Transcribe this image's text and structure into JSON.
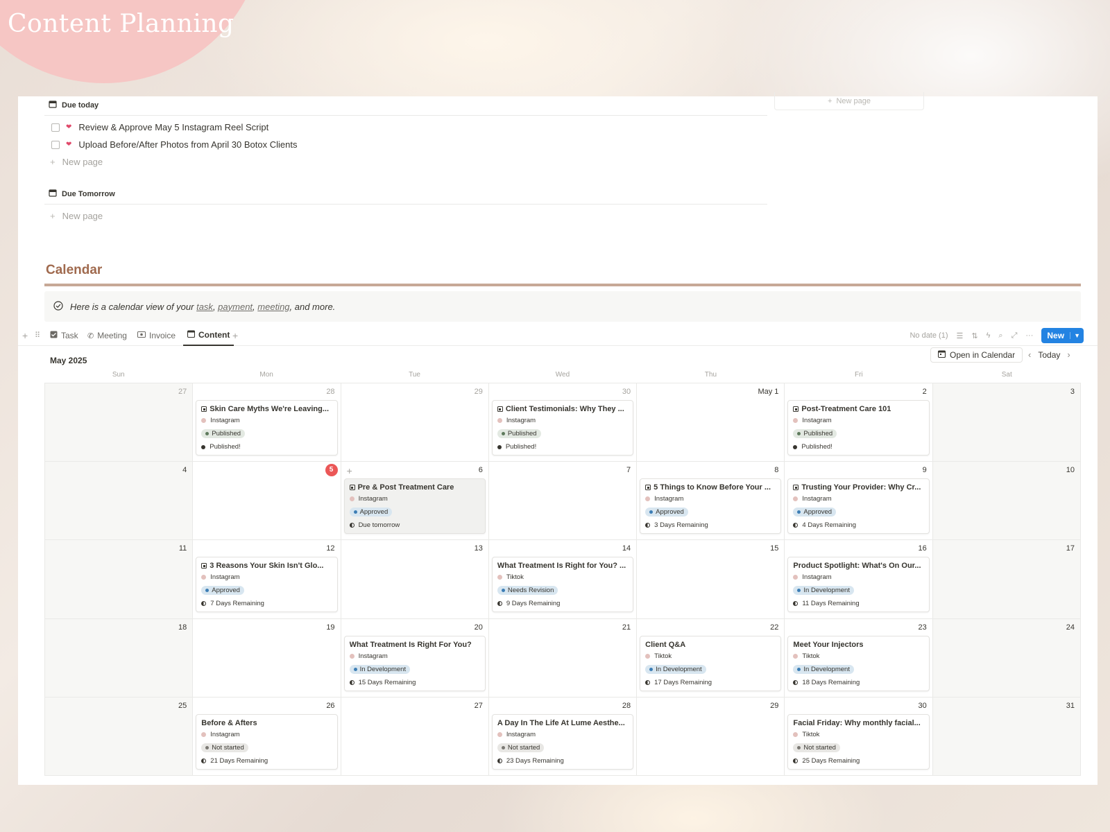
{
  "header": {
    "title": "Content Planning"
  },
  "due_today": {
    "label": "Due today",
    "items": [
      "Review & Approve May 5 Instagram Reel Script",
      "Upload Before/After Photos from April 30 Botox Clients"
    ],
    "new_page": "New page"
  },
  "due_tomorrow": {
    "label": "Due Tomorrow",
    "new_page": "New page"
  },
  "gallery": {
    "new_page": "New page"
  },
  "calendar": {
    "title": "Calendar",
    "callout_prefix": "Here is a calendar view of your ",
    "callout_task": "task",
    "callout_sep1": ", ",
    "callout_payment": "payment",
    "callout_sep2": ", ",
    "callout_meeting": "meeting",
    "callout_suffix": ", and more."
  },
  "tabs": [
    {
      "label": "Task",
      "icon": "checkbox-icon"
    },
    {
      "label": "Meeting",
      "icon": "phone-icon"
    },
    {
      "label": "Invoice",
      "icon": "money-icon"
    },
    {
      "label": "Content",
      "icon": "calendar-icon",
      "active": true
    }
  ],
  "toolbar": {
    "no_date": "No date (1)",
    "new_label": "New"
  },
  "cal_header": {
    "month": "May 2025",
    "open_in_calendar": "Open in Calendar",
    "today": "Today",
    "weekdays": [
      "Sun",
      "Mon",
      "Tue",
      "Wed",
      "Thu",
      "Fri",
      "Sat"
    ]
  },
  "colors": {
    "instagram": "#e3c1bd",
    "tiktok": "#e3c1bd",
    "published_bg": "#e3e9e2",
    "published_dot": "#5e7a5c",
    "approved_bg": "#d8e6f0",
    "approved_dot": "#3d7eb5",
    "revision_bg": "#d8e6f0",
    "revision_dot": "#3d7eb5",
    "dev_bg": "#d8e6f0",
    "dev_dot": "#3d7eb5",
    "notstarted_bg": "#e8e7e4",
    "notstarted_dot": "#7b7974"
  },
  "days": [
    {
      "label": "27",
      "muted": true
    },
    {
      "label": "28",
      "muted": true
    },
    {
      "label": "29",
      "muted": true
    },
    {
      "label": "30",
      "muted": true
    },
    {
      "label": "May 1"
    },
    {
      "label": "2"
    },
    {
      "label": "3"
    },
    {
      "label": "4"
    },
    {
      "label": "5",
      "today": true
    },
    {
      "label": "6",
      "plus": true
    },
    {
      "label": "7"
    },
    {
      "label": "8"
    },
    {
      "label": "9"
    },
    {
      "label": "10"
    },
    {
      "label": "11"
    },
    {
      "label": "12"
    },
    {
      "label": "13"
    },
    {
      "label": "14"
    },
    {
      "label": "15"
    },
    {
      "label": "16"
    },
    {
      "label": "17"
    },
    {
      "label": "18"
    },
    {
      "label": "19"
    },
    {
      "label": "20"
    },
    {
      "label": "21"
    },
    {
      "label": "22"
    },
    {
      "label": "23"
    },
    {
      "label": "24"
    },
    {
      "label": "25"
    },
    {
      "label": "26"
    },
    {
      "label": "27"
    },
    {
      "label": "28"
    },
    {
      "label": "29"
    },
    {
      "label": "30"
    },
    {
      "label": "31"
    }
  ],
  "events": [
    {
      "day": 1,
      "title": "Skin Care Myths We're Leaving...",
      "page_icon": true,
      "platform": "Instagram",
      "status": "Published",
      "status_key": "published",
      "due": "Published!",
      "due_type": "dot"
    },
    {
      "day": 3,
      "title": "Client Testimonials: Why They ...",
      "page_icon": true,
      "platform": "Instagram",
      "status": "Published",
      "status_key": "published",
      "due": "Published!",
      "due_type": "dot"
    },
    {
      "day": 5,
      "title": "Post-Treatment Care 101",
      "page_icon": true,
      "platform": "Instagram",
      "status": "Published",
      "status_key": "published",
      "due": "Published!",
      "due_type": "dot"
    },
    {
      "day": 9,
      "title": "Pre & Post Treatment Care",
      "page_icon": true,
      "platform": "Instagram",
      "status": "Approved",
      "status_key": "approved",
      "due": "Due tomorrow",
      "due_type": "moon",
      "hovered": true
    },
    {
      "day": 11,
      "title": "5 Things to Know Before Your ...",
      "page_icon": true,
      "platform": "Instagram",
      "status": "Approved",
      "status_key": "approved",
      "due": "3 Days Remaining",
      "due_type": "moon"
    },
    {
      "day": 12,
      "title": "Trusting Your Provider: Why Cr...",
      "page_icon": true,
      "platform": "Instagram",
      "status": "Approved",
      "status_key": "approved",
      "due": "4 Days Remaining",
      "due_type": "moon"
    },
    {
      "day": 15,
      "title": "3 Reasons Your Skin Isn't Glo...",
      "page_icon": true,
      "platform": "Instagram",
      "status": "Approved",
      "status_key": "approved",
      "due": "7 Days Remaining",
      "due_type": "moon"
    },
    {
      "day": 17,
      "title": "What Treatment Is Right for You? ...",
      "page_icon": false,
      "platform": "Tiktok",
      "status": "Needs Revision",
      "status_key": "revision",
      "due": "9 Days Remaining",
      "due_type": "moon"
    },
    {
      "day": 19,
      "title": "Product Spotlight: What's On Our...",
      "page_icon": false,
      "platform": "Instagram",
      "status": "In Development",
      "status_key": "dev",
      "due": "11 Days Remaining",
      "due_type": "moon"
    },
    {
      "day": 23,
      "title": "What Treatment Is Right For You?",
      "page_icon": false,
      "platform": "Instagram",
      "status": "In Development",
      "status_key": "dev",
      "due": "15 Days Remaining",
      "due_type": "moon"
    },
    {
      "day": 25,
      "title": "Client Q&A",
      "page_icon": false,
      "platform": "Tiktok",
      "status": "In Development",
      "status_key": "dev",
      "due": "17 Days Remaining",
      "due_type": "moon"
    },
    {
      "day": 26,
      "title": "Meet Your Injectors",
      "page_icon": false,
      "platform": "Tiktok",
      "status": "In Development",
      "status_key": "dev",
      "due": "18 Days Remaining",
      "due_type": "moon"
    },
    {
      "day": 29,
      "title": "Before & Afters",
      "page_icon": false,
      "platform": "Instagram",
      "status": "Not started",
      "status_key": "notstarted",
      "due": "21 Days Remaining",
      "due_type": "moon"
    },
    {
      "day": 31,
      "title": "A Day In The Life At Lume Aesthe...",
      "page_icon": false,
      "platform": "Instagram",
      "status": "Not started",
      "status_key": "notstarted",
      "due": "23 Days Remaining",
      "due_type": "moon"
    },
    {
      "day": 33,
      "title": "Facial Friday: Why monthly facial...",
      "page_icon": false,
      "platform": "Tiktok",
      "status": "Not started",
      "status_key": "notstarted",
      "due": "25 Days Remaining",
      "due_type": "moon"
    }
  ]
}
